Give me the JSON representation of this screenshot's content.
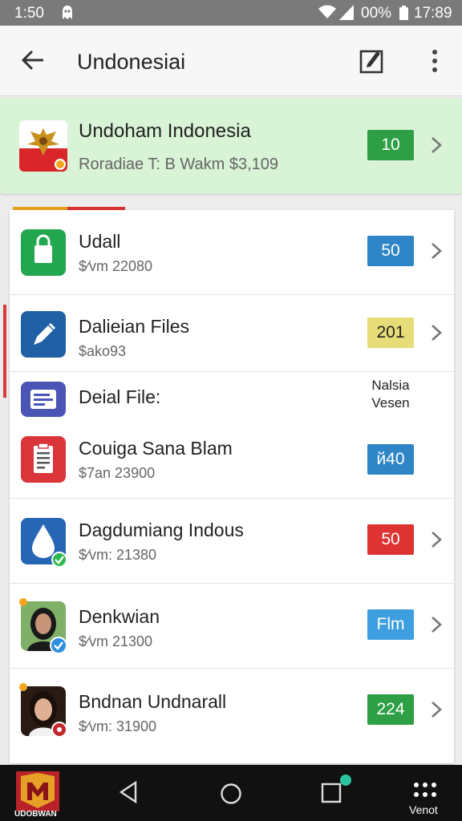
{
  "status_bar": {
    "time": "1:50",
    "battery_pct": "00%",
    "clock": "17:89"
  },
  "app_bar": {
    "title": "Undonesiai"
  },
  "featured": {
    "name": "Undoham Indonesia",
    "subtitle": "Roradiae T: B Wakm $3,109",
    "badge": "10",
    "badge_color": "#2e9f45"
  },
  "list": [
    {
      "name": "Udall",
      "subtitle": "$⁄vm 22080",
      "badge": "50",
      "badge_color": "#2f86c7",
      "icon": "shopping-bag-icon"
    },
    {
      "name": "Dalieian Files",
      "subtitle": "$ako93",
      "badge": "201",
      "badge_color": "#e6dc78",
      "icon": "pen-icon"
    },
    {
      "name": "Deial File:",
      "subtitle": "",
      "badge": "",
      "icon": "id-card-icon",
      "side_label": "Nalsia Vesen"
    },
    {
      "name": "Couiga Sana Blam",
      "subtitle": "$7an 23900",
      "badge": "й40",
      "badge_color": "#2f86c7",
      "icon": "clipboard-icon"
    },
    {
      "name": "Dagdumiang Indous",
      "subtitle": "$⁄vm: 21380",
      "badge": "50",
      "badge_color": "#dd3333",
      "icon": "drop-icon"
    },
    {
      "name": "Denkwian",
      "subtitle": "$⁄vm 21300",
      "badge": "Flm",
      "badge_color": "#3d9ee0",
      "icon": "avatar-woman-icon"
    },
    {
      "name": "Bndnan Undnarall",
      "subtitle": "$⁄vm: 31900",
      "badge": "224",
      "badge_color": "#2e9f45",
      "icon": "avatar-woman2-icon"
    }
  ],
  "nav": {
    "app_label": "UDOBWAN",
    "more_label": "Venot"
  }
}
